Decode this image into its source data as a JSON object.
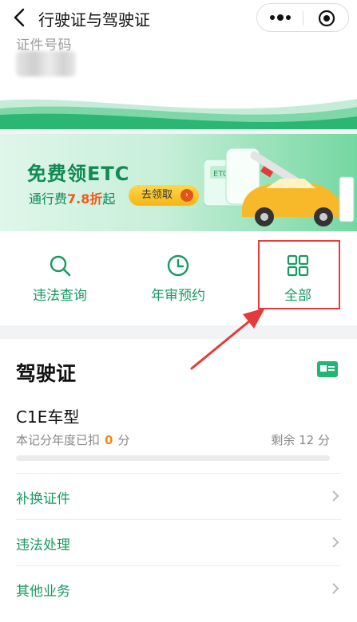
{
  "header": {
    "title": "行驶证与驾驶证"
  },
  "idcard": {
    "label": "证件号码"
  },
  "banner": {
    "title": "免费领ETC",
    "sub_prefix": "通行费",
    "sub_highlight": "7.8折",
    "sub_suffix": "起",
    "button": "去领取",
    "etc_tag": "ETC"
  },
  "actions": [
    {
      "label": "违法查询",
      "icon": "search-icon"
    },
    {
      "label": "年审预约",
      "icon": "clock-icon"
    },
    {
      "label": "全部",
      "icon": "grid-icon"
    }
  ],
  "license": {
    "title": "驾驶证",
    "class": "C1E车型",
    "deducted_prefix": "本记分年度已扣",
    "deducted": "0",
    "deducted_unit": "分",
    "remaining": "剩余 12 分",
    "points_deducted_fraction": 0
  },
  "menu": [
    {
      "label": "补换证件"
    },
    {
      "label": "违法处理"
    },
    {
      "label": "其他业务"
    }
  ],
  "colors": {
    "brand": "#1a9a63",
    "accent_green": "#22b573",
    "highlight_red": "#e33b3b",
    "deduct_orange": "#f08a1a"
  }
}
